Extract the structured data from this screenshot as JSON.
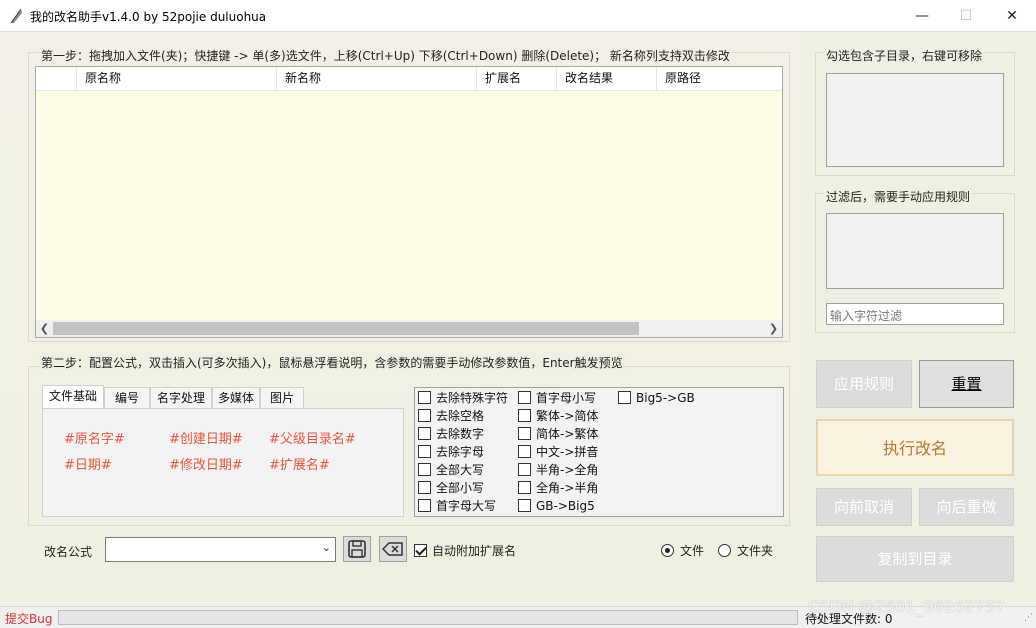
{
  "window": {
    "title": "我的改名助手v1.4.0 by 52pojie duluohua",
    "minimize": "—",
    "maximize": "☐",
    "close": "✕"
  },
  "step1": {
    "label": "第一步：拖拽加入文件(夹)；快捷键 -> 单(多)选文件，上移(Ctrl+Up) 下移(Ctrl+Down) 删除(Delete)； 新名称列支持双击修改",
    "columns": [
      "原名称",
      "新名称",
      "扩展名",
      "改名结果",
      "原路径"
    ]
  },
  "right": {
    "subdir_label": "勾选包含子目录，右键可移除",
    "filter_label": "过滤后，需要手动应用规则",
    "filter_placeholder": "输入字符过滤",
    "apply_button": "应用规则",
    "reset_button": "重置",
    "execute_button": "执行改名",
    "undo_button": "向前取消",
    "redo_button": "向后重做",
    "copy_button": "复制到目录"
  },
  "step2": {
    "label": "第二步：配置公式，双击插入(可多次插入)，鼠标悬浮看说明，含参数的需要手动修改参数值，Enter触发预览",
    "tabs": [
      "文件基础",
      "编号",
      "名字处理",
      "多媒体",
      "图片"
    ],
    "tokens": [
      "#原名字#",
      "#创建日期#",
      "#父级目录名#",
      "#日期#",
      "#修改日期#",
      "#扩展名#"
    ],
    "options_col1": [
      "去除特殊字符",
      "去除空格",
      "去除数字",
      "去除字母",
      "全部大写",
      "全部小写",
      "首字母大写"
    ],
    "options_col2": [
      "首字母小写",
      "繁体->简体",
      "简体->繁体",
      "中文->拼音",
      "半角->全角",
      "全角->半角",
      "GB->Big5"
    ],
    "options_col3": [
      "Big5->GB"
    ]
  },
  "formula": {
    "label": "改名公式",
    "value": "",
    "auto_ext_label": "自动附加扩展名",
    "auto_ext_checked": true,
    "radio_file": "文件",
    "radio_folder": "文件夹",
    "selected": "文件"
  },
  "status": {
    "bug_link": "提交Bug",
    "pending_label": "待处理文件数: 0",
    "watermark": "CSDN @2501_90262737"
  },
  "colors": {
    "token": "#e8553a",
    "bug": "#e03030",
    "execute_bg": "#fbf3e2",
    "execute_text": "#b07a2a"
  }
}
